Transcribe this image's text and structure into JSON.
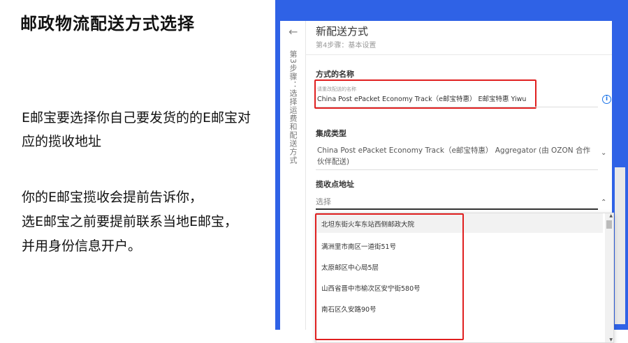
{
  "slide": {
    "title": "邮政物流配送方式选择",
    "para1": "E邮宝要选择你自己要发货的的E邮宝对应的揽收地址",
    "para2_line1": "你的E邮宝揽收会提前告诉你，",
    "para2_line2": "选E邮宝之前要提前联系当地E邮宝，",
    "para2_line3": "并用身份信息开户。"
  },
  "panel": {
    "side_label": "第3步骤：选择运费和配送方式",
    "title": "新配送方式",
    "subtitle": "第4步骤：基本设置",
    "name_label": "方式的名称",
    "name_placeholder": "请重改配送的名称",
    "name_value": "China Post ePacket Economy Track（e邮宝特惠） E邮宝特惠 Yiwu",
    "integration_label": "集成类型",
    "integration_value": "China Post ePacket Economy Track（e邮宝特惠） Aggregator (由 OZON 合作伙伴配送)",
    "pickup_label": "揽收点地址",
    "pickup_placeholder": "选择",
    "options": [
      "北坦东街火车东站西侧邮政大院",
      "满洲里市南区一道街51号",
      "太原邮区中心局5层",
      "山西省晋中市榆次区安宁街580号",
      "南石区久安路90号"
    ]
  },
  "colors": {
    "accent_frame": "#2f62e6",
    "highlight": "#e01f1f",
    "link": "#1a73e8"
  }
}
